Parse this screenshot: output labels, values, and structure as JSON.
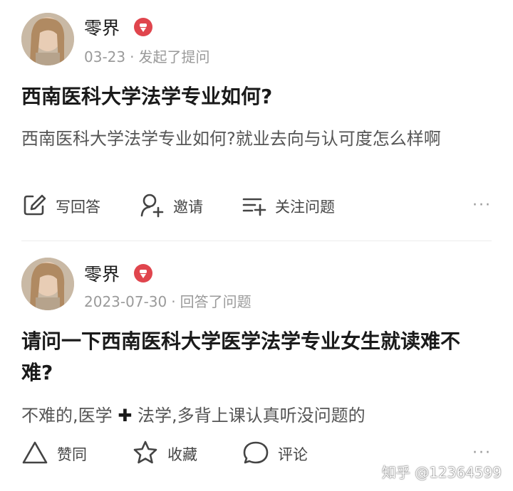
{
  "posts": [
    {
      "author": "零界",
      "badge_icon": "ice-cream-badge-icon",
      "date": "03-23",
      "separator": "·",
      "action": "发起了提问",
      "title": "西南医科大学法学专业如何?",
      "excerpt": "西南医科大学法学专业如何?就业去向与认可度怎么样啊",
      "actions": [
        {
          "icon": "edit-icon",
          "label": "写回答"
        },
        {
          "icon": "invite-user-icon",
          "label": "邀请"
        },
        {
          "icon": "follow-list-icon",
          "label": "关注问题"
        }
      ],
      "more": "···"
    },
    {
      "author": "零界",
      "badge_icon": "ice-cream-badge-icon",
      "date": "2023-07-30",
      "separator": "·",
      "action": "回答了问题",
      "title": "请问一下西南医科大学医学法学专业女生就读难不难?",
      "excerpt_part1": "不难的,医学 ",
      "excerpt_plus": "✚",
      "excerpt_part2": " 法学,多背上课认真听没问题的",
      "actions": [
        {
          "icon": "upvote-triangle-icon",
          "label": "赞同"
        },
        {
          "icon": "star-icon",
          "label": "收藏"
        },
        {
          "icon": "comment-bubble-icon",
          "label": "评论"
        }
      ],
      "more": "···"
    }
  ],
  "watermark": "知乎 @12364599",
  "colors": {
    "badge": "#e0454d",
    "meta": "#9a9a9a",
    "text": "#1a1a1a"
  }
}
